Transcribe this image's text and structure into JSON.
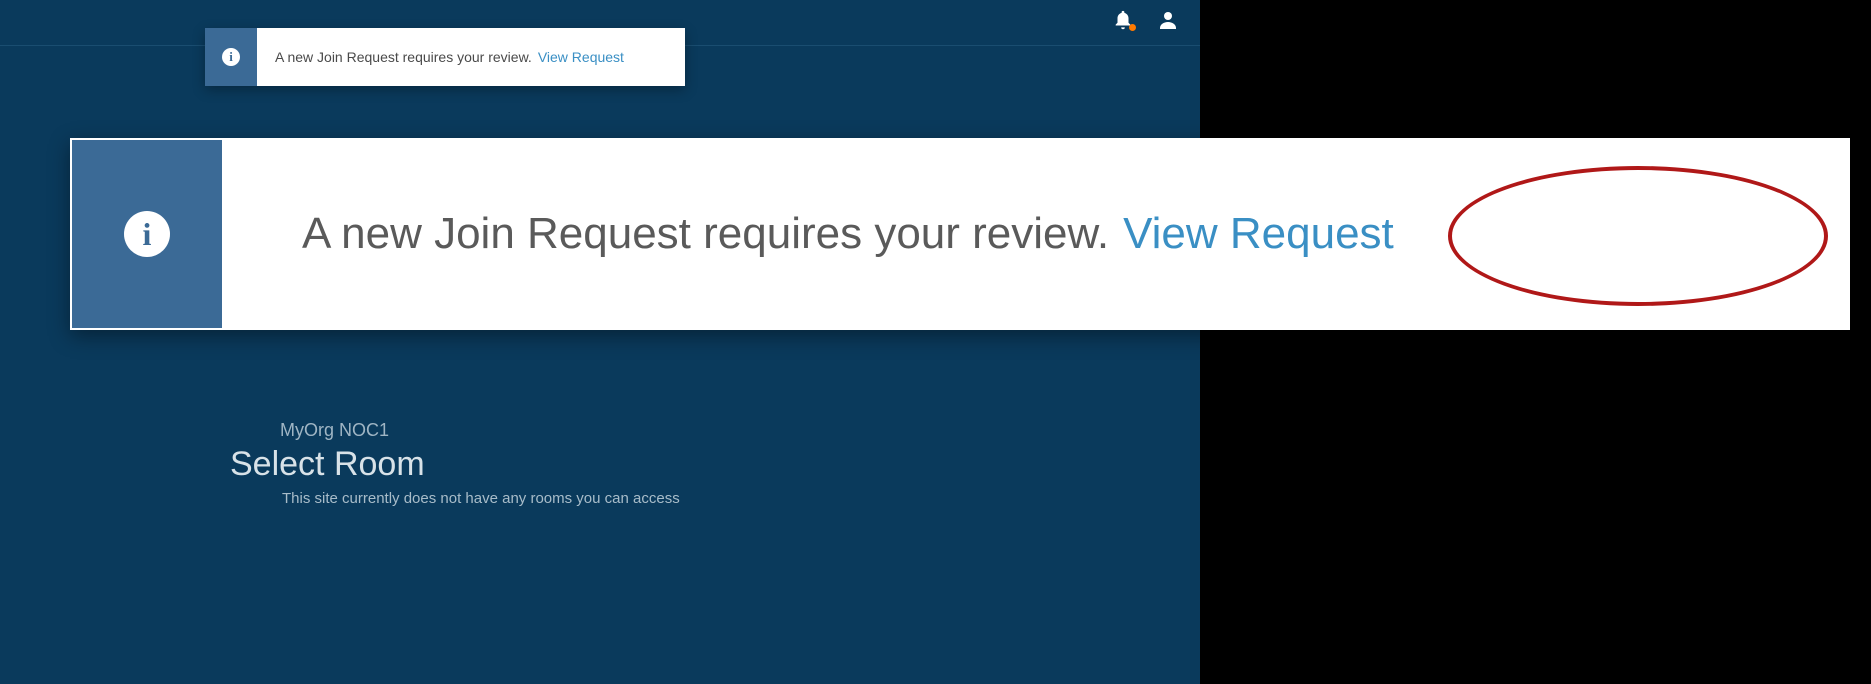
{
  "notification": {
    "message": "A new Join Request requires your review.",
    "link_label": "View Request"
  },
  "page": {
    "org_site": "MyOrg NOC1",
    "heading": "Select Room",
    "empty_message": "This site currently does not have any rooms you can access"
  },
  "icons": {
    "bell": "bell-icon",
    "user": "user-icon",
    "info": "info-icon"
  }
}
